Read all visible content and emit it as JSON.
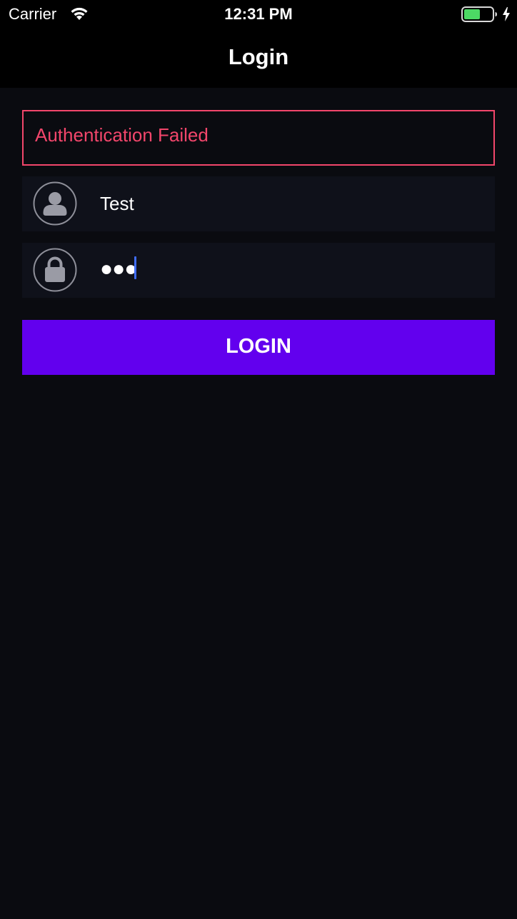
{
  "status_bar": {
    "carrier": "Carrier",
    "time": "12:31 PM",
    "wifi_icon": "wifi-icon",
    "battery_icon": "battery-icon",
    "charging_icon": "charging-bolt-icon",
    "battery_color": "#4cd964"
  },
  "nav": {
    "title": "Login"
  },
  "error": {
    "message": "Authentication Failed",
    "color": "#f2466b"
  },
  "form": {
    "username": {
      "icon": "user-icon",
      "value": "Test"
    },
    "password": {
      "icon": "lock-icon",
      "masked_value": "●●●",
      "caret_color": "#3f6cf5"
    },
    "submit": {
      "label": "LOGIN",
      "color": "#6200ee"
    }
  }
}
